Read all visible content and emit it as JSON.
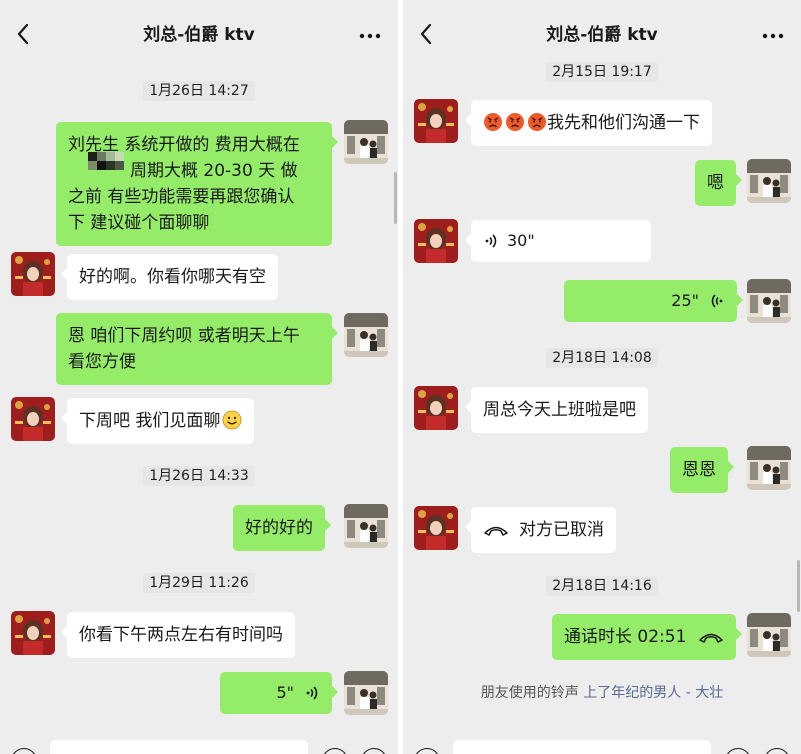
{
  "left": {
    "title": "刘总-伯爵 ktv",
    "ts1": "1月26日 14:27",
    "msg1": [
      "刘先生 系统开做的 费用大概在",
      "周期大概 20-30 天 做",
      "之前 有些功能需要再跟您确认",
      "下 建议碰个面聊聊"
    ],
    "msg1_prefix": "刘先生 系统开做的 费用大概在",
    "msg2": "好的啊。你看你哪天有空",
    "msg3": [
      "恩 咱们下周约呗 或者明天上午",
      "看您方便"
    ],
    "msg4": "下周吧 我们见面聊",
    "ts2": "1月26日 14:33",
    "msg5": "好的好的",
    "ts3": "1月29日 11:26",
    "msg6": "你看下午两点左右有时间吗",
    "voice_out": "5\""
  },
  "right": {
    "title": "刘总-伯爵 ktv",
    "ts1": "2月15日 19:17",
    "msg1": "我先和他们沟通一下",
    "msg2": "嗯",
    "voice_in": "30\"",
    "voice_out": "25\"",
    "ts2": "2月18日 14:08",
    "msg3": "周总今天上班啦是吧",
    "msg4": "恩恩",
    "call_cancel": "对方已取消",
    "ts3": "2月18日 14:16",
    "call_duration": "通话时长 02:51",
    "ringtone_prefix": "朋友使用的铃声",
    "ringtone_song": "上了年纪的男人 - 大壮"
  },
  "icons": {
    "back": "chevron-left-icon",
    "more": "more-dots-icon",
    "voice": "voice-wave-icon",
    "phone": "phone-hangup-icon",
    "emoji": "smile-emoji-icon",
    "angry": "angry-emoji-icon"
  },
  "colors": {
    "background": "#ededed",
    "bubble_out": "#95ec69",
    "bubble_in": "#ffffff",
    "link": "#576b95"
  }
}
